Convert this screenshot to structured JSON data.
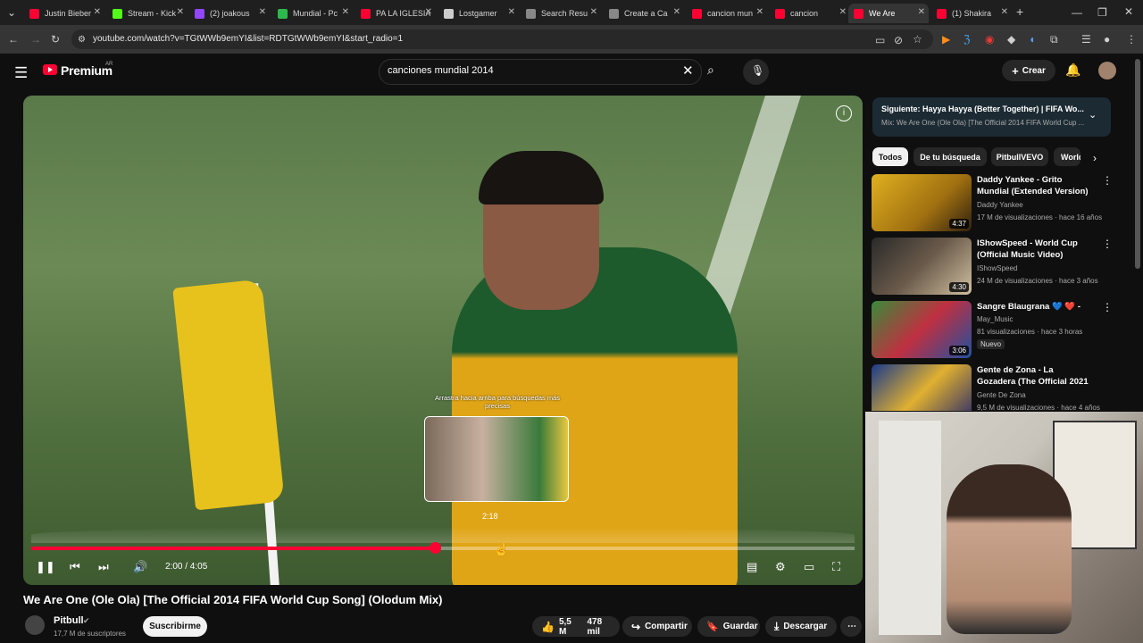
{
  "browser": {
    "tabs": [
      {
        "label": "Justin Bieber",
        "color": "#ff0033"
      },
      {
        "label": "Stream - Kick",
        "color": "#53fc18"
      },
      {
        "label": "(2) joakous",
        "color": "#9146ff"
      },
      {
        "label": "Mundial - Pc",
        "color": "#2db84d"
      },
      {
        "label": "PA LA IGLESIA",
        "color": "#ff0033"
      },
      {
        "label": "Lostgamer",
        "color": "#cccccc"
      },
      {
        "label": "Search Resu",
        "color": "#888888"
      },
      {
        "label": "Create a Ca",
        "color": "#888888"
      },
      {
        "label": "cancion mun",
        "color": "#ff0033"
      },
      {
        "label": "cancion",
        "color": "#ff0033"
      },
      {
        "label": "We Are",
        "color": "#ff0033",
        "active": true
      },
      {
        "label": "(1) Shakira",
        "color": "#ff0033"
      }
    ],
    "url": "youtube.com/watch?v=TGtWWb9emYI&list=RDTGtWWb9emYI&start_radio=1"
  },
  "header": {
    "logo": "Premium",
    "region": "AR",
    "search_value": "canciones mundial 2014",
    "create_label": "Crear"
  },
  "player": {
    "hint": "Arrastra hacia arriba para búsquedas más precisas",
    "preview_time": "2:18",
    "time_display": "2:00 / 4:05",
    "progress_fraction": 0.49
  },
  "video": {
    "title": "We Are One (Ole Ola) [The Official 2014 FIFA World Cup Song] (Olodum Mix)",
    "channel": "Pitbull",
    "subscribers": "17,7 M de suscriptores",
    "subscribe_label": "Suscribirme",
    "likes": "5,5 M",
    "comments": "478 mil",
    "share_label": "Compartir",
    "save_label": "Guardar",
    "download_label": "Descargar"
  },
  "upnext": {
    "title": "Siguiente: Hayya Hayya (Better Together) | FIFA Wo...",
    "subtitle": "Mix: We Are One (Ole Ola) [The Official 2014 FIFA World Cup ..."
  },
  "chips": [
    "Todos",
    "De tu búsqueda",
    "PitbullVEVO",
    "World"
  ],
  "recommendations": [
    {
      "title": "Daddy Yankee - Grito Mundial (Extended Version)",
      "channel": "Daddy Yankee",
      "meta": "17 M de visualizaciones · hace 16 años",
      "duration": "4:37"
    },
    {
      "title": "IShowSpeed - World Cup (Official Music Video)",
      "channel": "IShowSpeed",
      "meta": "24 M de visualizaciones · hace 3 años",
      "duration": "4:30"
    },
    {
      "title": "Sangre Blaugrana 💙 ❤️ - May",
      "channel": "May_Music",
      "meta": "81 visualizaciones · hace 3 horas",
      "duration": "3:06",
      "badge": "Nuevo"
    },
    {
      "title": "Gente de Zona - La Gozadera (The Official 2021 Conmebol ...",
      "channel": "Gente De Zona",
      "meta": "9,5 M de visualizaciones · hace 4 años",
      "duration": ""
    }
  ]
}
